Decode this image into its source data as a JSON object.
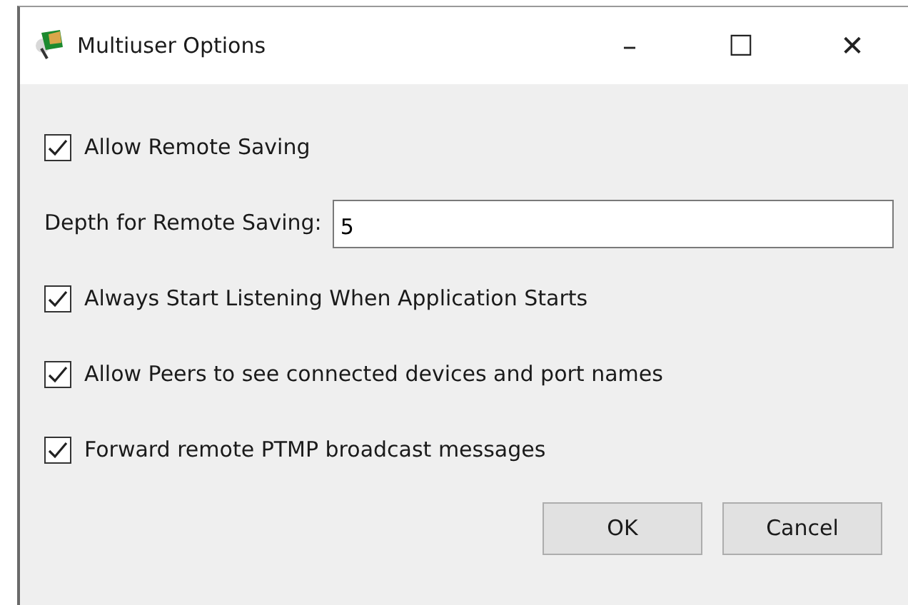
{
  "window": {
    "title": "Multiuser Options",
    "controls": [
      "–",
      "☐",
      "✕"
    ]
  },
  "options": [
    {
      "kind": "checkbox",
      "label": "Allow Remote Saving",
      "checked": true
    },
    {
      "kind": "field",
      "label": "Depth for Remote Saving:",
      "value": "5"
    },
    {
      "kind": "checkbox",
      "label": "Always Start Listening When Application Starts",
      "checked": true
    },
    {
      "kind": "checkbox",
      "label": "Allow Peers to see connected devices and port names",
      "checked": true
    },
    {
      "kind": "checkbox",
      "label": "Forward remote PTMP broadcast messages",
      "checked": true
    }
  ],
  "buttons": [
    "OK",
    "Cancel"
  ]
}
